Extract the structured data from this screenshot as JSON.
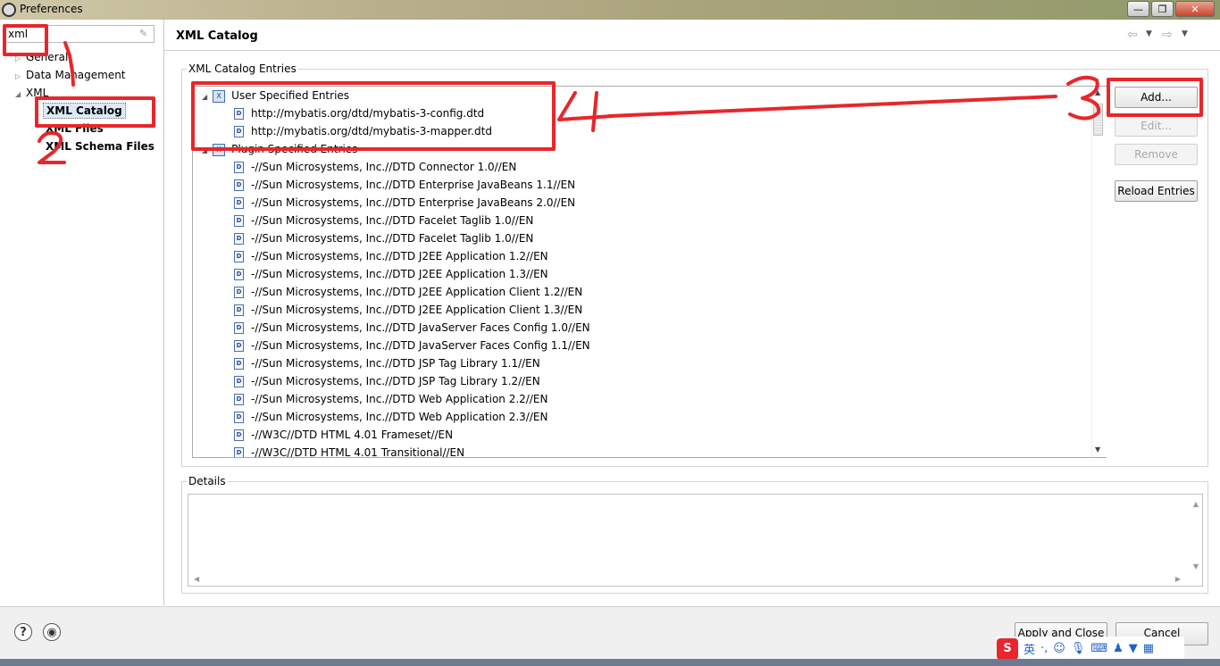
{
  "window": {
    "title": "Preferences",
    "controls": {
      "minimize": "—",
      "maximize": "❐",
      "close": "✕"
    }
  },
  "sidebar": {
    "filter_value": "xml",
    "tree": [
      {
        "label": "General",
        "expanded": false
      },
      {
        "label": "Data Management",
        "expanded": false
      },
      {
        "label": "XML",
        "expanded": true,
        "children": [
          {
            "label": "XML Catalog",
            "selected": true
          },
          {
            "label": "XML Files"
          },
          {
            "label": "XML Schema Files"
          }
        ]
      }
    ]
  },
  "page": {
    "title": "XML Catalog",
    "entries_group_label": "XML Catalog Entries",
    "user_entries_label": "User Specified Entries",
    "user_entries": [
      "http://mybatis.org/dtd/mybatis-3-config.dtd",
      "http://mybatis.org/dtd/mybatis-3-mapper.dtd"
    ],
    "plugin_entries_label": "Plugin Specified Entries",
    "plugin_entries": [
      "-//Sun Microsystems, Inc.//DTD Connector 1.0//EN",
      "-//Sun Microsystems, Inc.//DTD Enterprise JavaBeans 1.1//EN",
      "-//Sun Microsystems, Inc.//DTD Enterprise JavaBeans 2.0//EN",
      "-//Sun Microsystems, Inc.//DTD Facelet Taglib 1.0//EN",
      "-//Sun Microsystems, Inc.//DTD Facelet Taglib 1.0//EN",
      "-//Sun Microsystems, Inc.//DTD J2EE Application 1.2//EN",
      "-//Sun Microsystems, Inc.//DTD J2EE Application 1.3//EN",
      "-//Sun Microsystems, Inc.//DTD J2EE Application Client 1.2//EN",
      "-//Sun Microsystems, Inc.//DTD J2EE Application Client 1.3//EN",
      "-//Sun Microsystems, Inc.//DTD JavaServer Faces Config 1.0//EN",
      "-//Sun Microsystems, Inc.//DTD JavaServer Faces Config 1.1//EN",
      "-//Sun Microsystems, Inc.//DTD JSP Tag Library 1.1//EN",
      "-//Sun Microsystems, Inc.//DTD JSP Tag Library 1.2//EN",
      "-//Sun Microsystems, Inc.//DTD Web Application 2.2//EN",
      "-//Sun Microsystems, Inc.//DTD Web Application 2.3//EN",
      "-//W3C//DTD HTML 4.01 Frameset//EN",
      "-//W3C//DTD HTML 4.01 Transitional//EN"
    ],
    "buttons": {
      "add": "Add...",
      "edit": "Edit...",
      "remove": "Remove",
      "reload": "Reload Entries"
    },
    "details_label": "Details"
  },
  "footer": {
    "apply_close": "Apply and Close",
    "cancel": "Cancel"
  },
  "ime": {
    "lang": "英"
  },
  "annotations": {
    "color": "#e8262b",
    "marks": [
      "1",
      "2",
      "3",
      "4"
    ]
  }
}
